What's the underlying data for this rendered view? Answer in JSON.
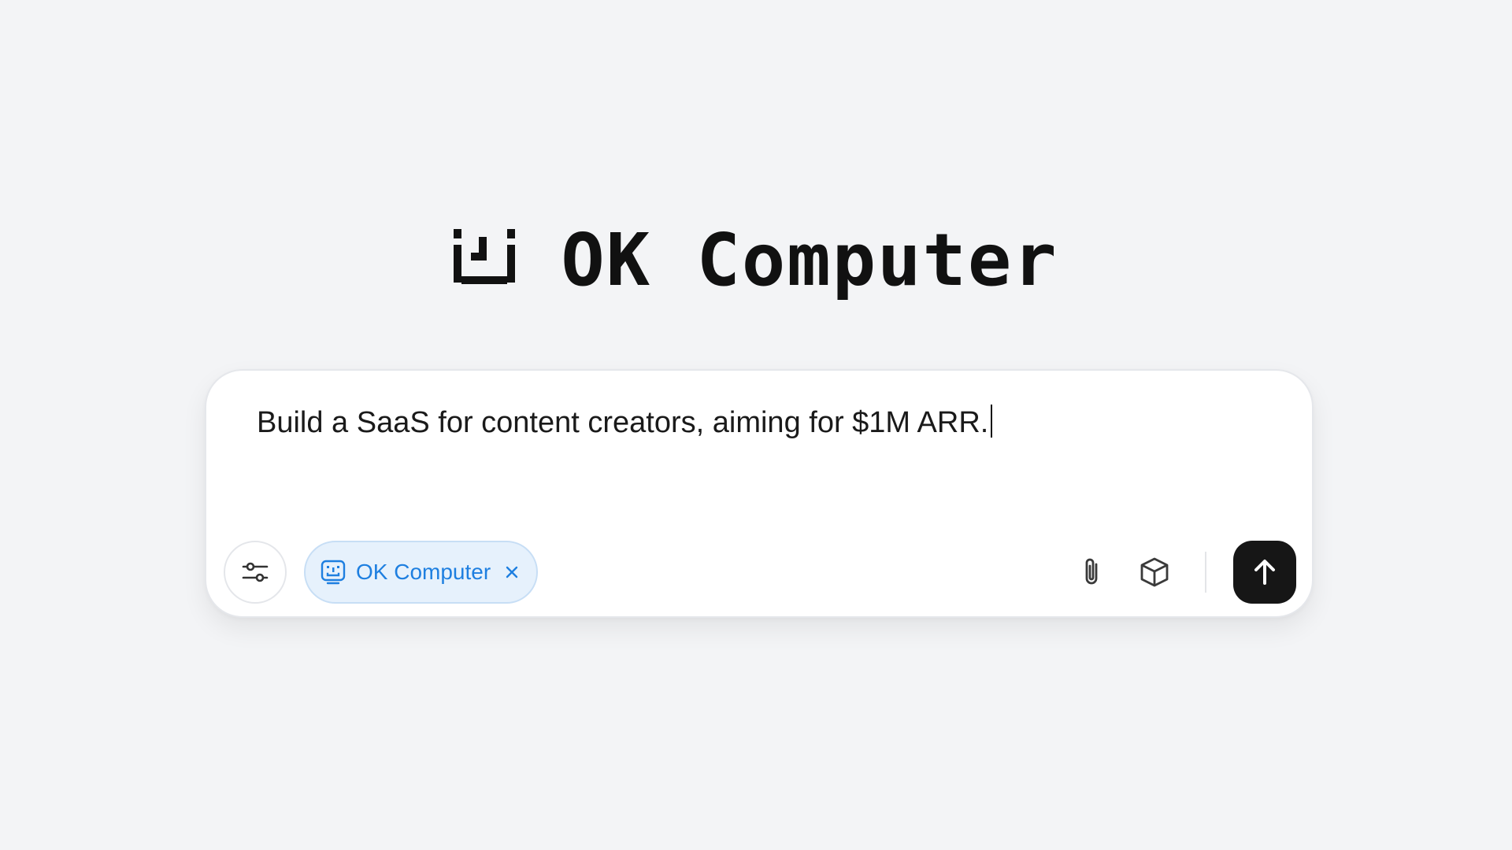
{
  "hero": {
    "title": "OK Computer",
    "logo_icon": "pixel-smiley-icon"
  },
  "composer": {
    "prompt_text": "Build a SaaS for content creators, aiming for $1M ARR.",
    "settings_icon": "sliders-icon",
    "chip": {
      "label": "OK Computer",
      "icon": "ok-computer-face-icon",
      "close_icon": "close-icon"
    },
    "tools": {
      "attach_icon": "paperclip-icon",
      "box_icon": "cube-icon"
    },
    "send_icon": "arrow-up-icon"
  },
  "colors": {
    "background": "#f3f4f6",
    "card": "#ffffff",
    "chip_bg": "#e6f1fc",
    "chip_accent": "#1e7fe0",
    "send_button": "#161616"
  }
}
